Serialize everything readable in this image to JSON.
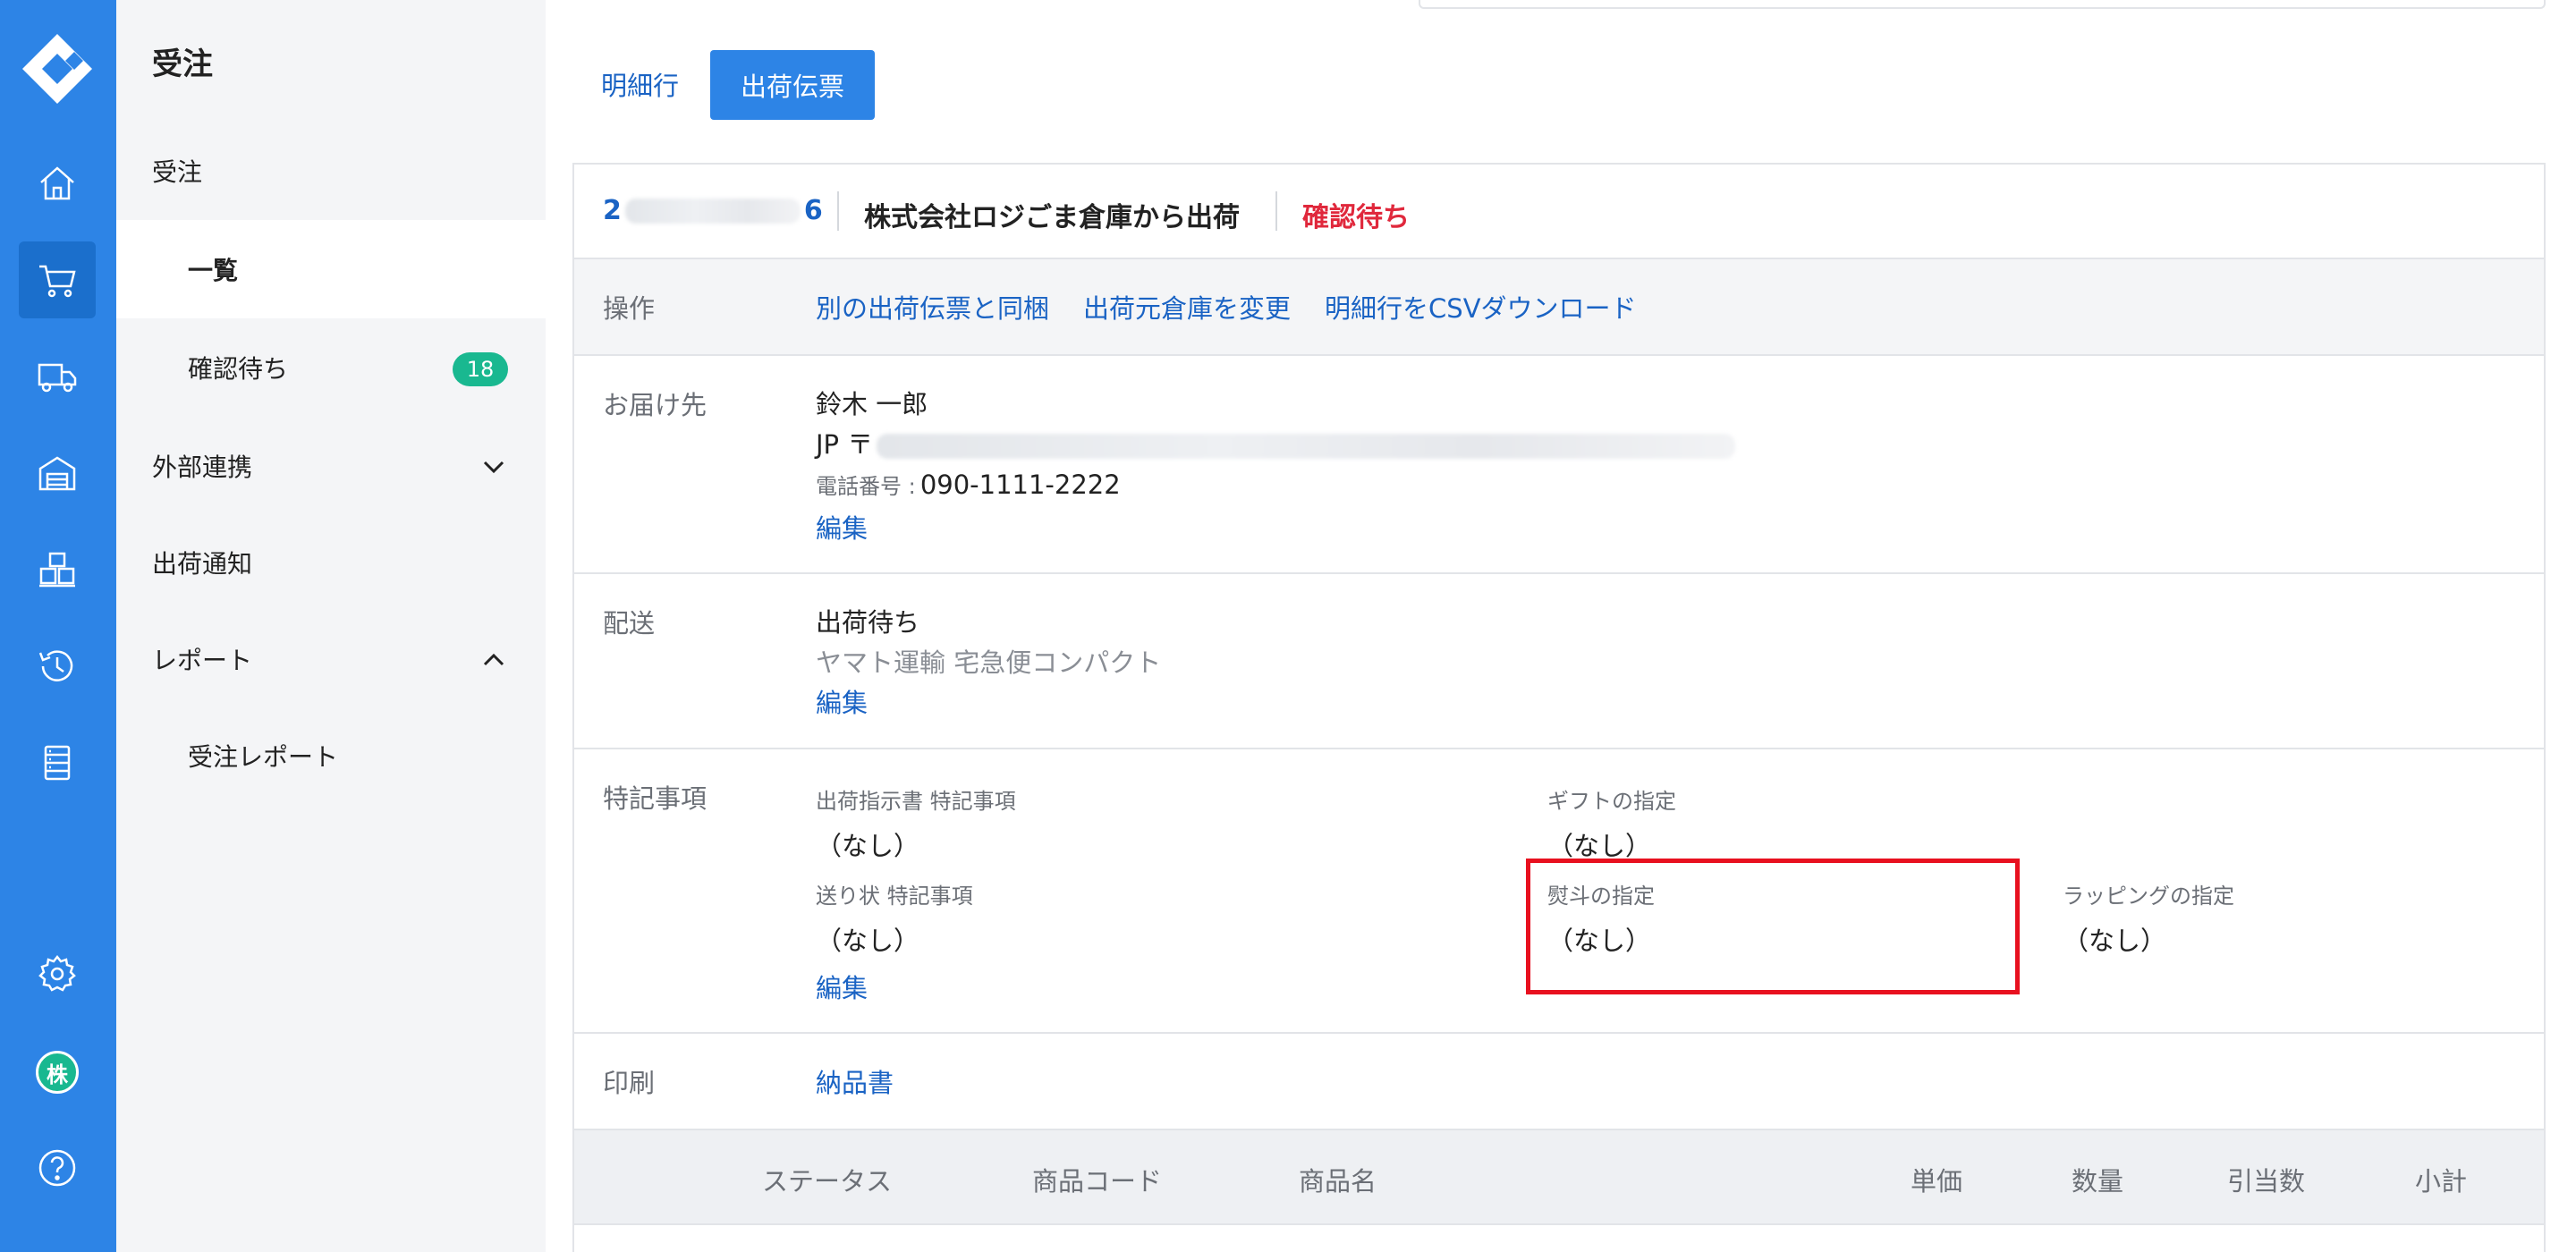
{
  "sidebar": {
    "title": "受注",
    "items": [
      {
        "label": "受注"
      },
      {
        "label": "一覧"
      },
      {
        "label": "確認待ち",
        "badge": "18"
      },
      {
        "label": "外部連携"
      },
      {
        "label": "出荷通知"
      },
      {
        "label": "レポート"
      },
      {
        "label": "受注レポート"
      }
    ]
  },
  "rail": {
    "avatar_text": "株",
    "icons": [
      "home-icon",
      "cart-icon",
      "truck-icon",
      "warehouse-icon",
      "boxes-icon",
      "history-icon",
      "list-icon",
      "gear-icon",
      "help-icon"
    ]
  },
  "tabs": {
    "lines": "明細行",
    "slip": "出荷伝票"
  },
  "order": {
    "id_start": "2",
    "id_end": "6",
    "warehouse": "株式会社ロジごま倉庫から出荷",
    "status": "確認待ち"
  },
  "operations": {
    "label": "操作",
    "links": [
      "別の出荷伝票と同梱",
      "出荷元倉庫を変更",
      "明細行をCSVダウンロード"
    ]
  },
  "destination": {
    "label": "お届け先",
    "name": "鈴木 一郎",
    "address_prefix": "JP 〒",
    "phone_label": "電話番号 :",
    "phone": "090-1111-2222",
    "edit": "編集"
  },
  "shipping": {
    "label": "配送",
    "status": "出荷待ち",
    "carrier": "ヤマト運輸 宅急便コンパクト",
    "edit": "編集"
  },
  "notes": {
    "label": "特記事項",
    "instruction_label": "出荷指示書 特記事項",
    "instruction_value": "（なし）",
    "gift_label": "ギフトの指定",
    "gift_value": "（なし）",
    "invoice_label": "送り状 特記事項",
    "invoice_value": "（なし）",
    "noshi_label": "熨斗の指定",
    "noshi_value": "（なし）",
    "wrapping_label": "ラッピングの指定",
    "wrapping_value": "（なし）",
    "edit": "編集"
  },
  "print": {
    "label": "印刷",
    "link": "納品書"
  },
  "table": {
    "headers": [
      "ステータス",
      "商品コード",
      "商品名",
      "単価",
      "数量",
      "引当数",
      "小計"
    ]
  },
  "colors": {
    "primary": "#2d84e6",
    "link": "#1a63c4",
    "status_red": "#e0283c",
    "badge_green": "#19b890",
    "highlight_red": "#e8101f"
  }
}
